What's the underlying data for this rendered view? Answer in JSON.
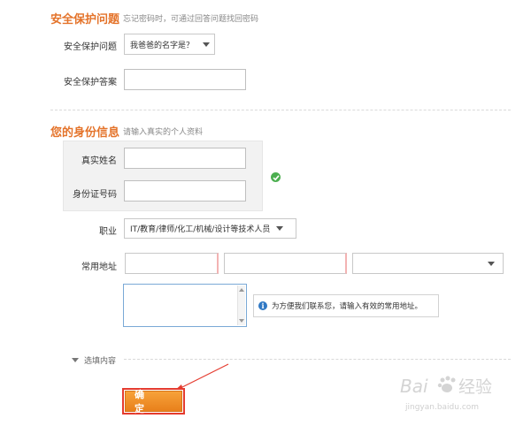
{
  "security_section": {
    "title": "安全保护问题",
    "hint": "忘记密码时，可通过回答问题找回密码",
    "question_label": "安全保护问题",
    "question_value": "我爸爸的名字是？",
    "answer_label": "安全保护答案",
    "answer_value": ""
  },
  "identity_section": {
    "title": "您的身份信息",
    "hint": "请输入真实的个人资料",
    "name_label": "真实姓名",
    "name_value": "",
    "id_label": "身份证号码",
    "id_value": "",
    "job_label": "职业",
    "job_value": "IT/教育/律师/化工/机械/设计等技术人员",
    "address_label": "常用地址",
    "address_tip": "为方便我们联系您，请输入有效的常用地址。"
  },
  "optional": {
    "label": "选填内容"
  },
  "confirm_button": {
    "label": "确 定"
  },
  "watermark": {
    "brand": "Baidu经验",
    "url": "jingyan.baidu.com"
  },
  "colors": {
    "section_title": "#e4732a",
    "confirm_button": "#f08c22",
    "annotation_arrow": "#e53b2e",
    "check": "#4caf50"
  }
}
